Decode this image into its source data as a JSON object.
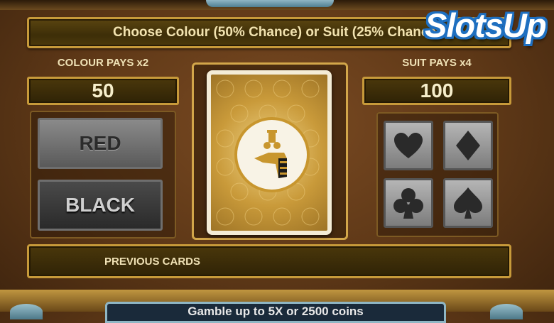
{
  "banner": {
    "text": "Choose Colour (50% Chance) or Suit (25% Chance"
  },
  "logo": {
    "text": "SlotsUp"
  },
  "colour": {
    "label": "COLOUR PAYS x2",
    "value": "50",
    "buttons": {
      "red": "RED",
      "black": "BLACK"
    }
  },
  "suit": {
    "label": "SUIT PAYS x4",
    "value": "100",
    "buttons": [
      "heart-icon",
      "diamond-icon",
      "club-icon",
      "spade-icon"
    ]
  },
  "previous_cards": {
    "label": "PREVIOUS CARDS"
  },
  "footer": {
    "message": "Gamble up to 5X or 2500 coins"
  },
  "colors": {
    "gold_border": "#c79a3a",
    "panel_dark": "#2f2306",
    "text_cream": "#f0e2b6",
    "logo_blue": "#1e6fc0",
    "logo_pink": "#e6559b"
  }
}
